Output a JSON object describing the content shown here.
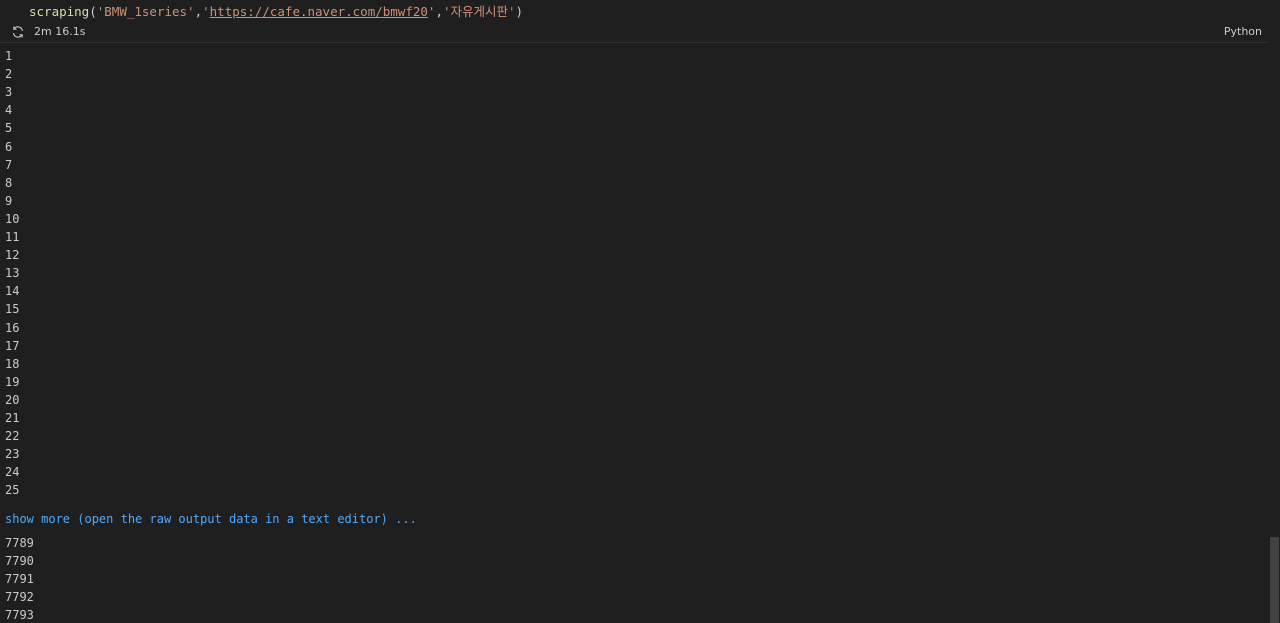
{
  "cell": {
    "code": {
      "fn": "scraping",
      "arg1": "'BMW_1series'",
      "arg2_open": "'",
      "arg2_url": "https://cafe.naver.com/bmwf20",
      "arg2_close": "'",
      "arg3": "'자유게시판'"
    },
    "status": {
      "icon": "refresh-icon",
      "duration": "2m 16.1s",
      "language": "Python"
    }
  },
  "output": {
    "head_lines": [
      "1",
      "2",
      "3",
      "4",
      "5",
      "6",
      "7",
      "8",
      "9",
      "10",
      "11",
      "12",
      "13",
      "14",
      "15",
      "16",
      "17",
      "18",
      "19",
      "20",
      "21",
      "22",
      "23",
      "24",
      "25"
    ],
    "show_more": "show more (open the raw output data in a text editor) ...",
    "tail_lines": [
      "7789",
      "7790",
      "7791",
      "7792",
      "7793"
    ]
  },
  "colors": {
    "background": "#1f1f1f",
    "text": "#cccccc",
    "link": "#4daafc",
    "string": "#ce9178",
    "function": "#dcdcaa"
  }
}
